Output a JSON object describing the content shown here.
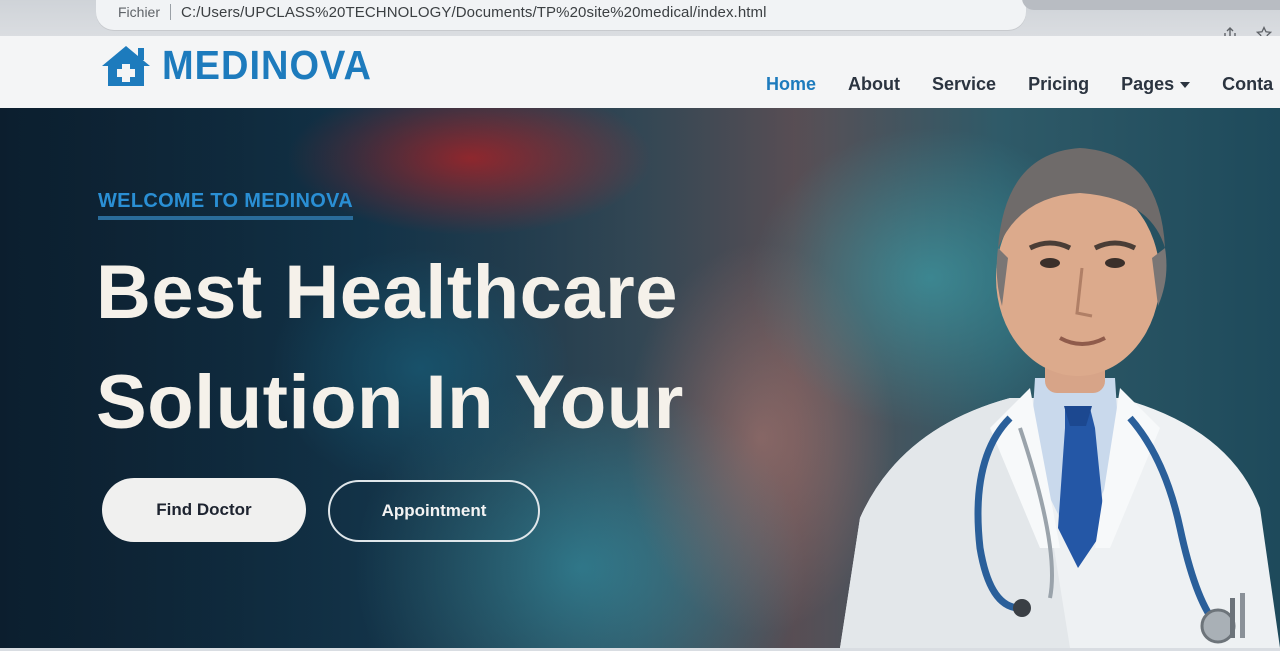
{
  "browser": {
    "status_label": "Fichier",
    "url": "C:/Users/UPCLASS%20TECHNOLOGY/Documents/TP%20site%20medical/index.html"
  },
  "site": {
    "brand": "MEDINOVA",
    "nav": [
      {
        "label": "Home",
        "active": true
      },
      {
        "label": "About"
      },
      {
        "label": "Service"
      },
      {
        "label": "Pricing"
      },
      {
        "label": "Pages",
        "dropdown": true
      },
      {
        "label": "Conta"
      }
    ]
  },
  "hero": {
    "eyebrow": "WELCOME TO MEDINOVA",
    "headline_line1": "Best Healthcare",
    "headline_line2": "Solution In Your",
    "primary_button": "Find Doctor",
    "secondary_button": "Appointment"
  },
  "colors": {
    "brand_blue": "#1d7bbd",
    "nav_text": "#2b3440",
    "hero_text": "#f5f1ea"
  },
  "icons": [
    "share-icon",
    "bookmark-star-icon",
    "hospital-house-icon",
    "chevron-down-icon"
  ]
}
